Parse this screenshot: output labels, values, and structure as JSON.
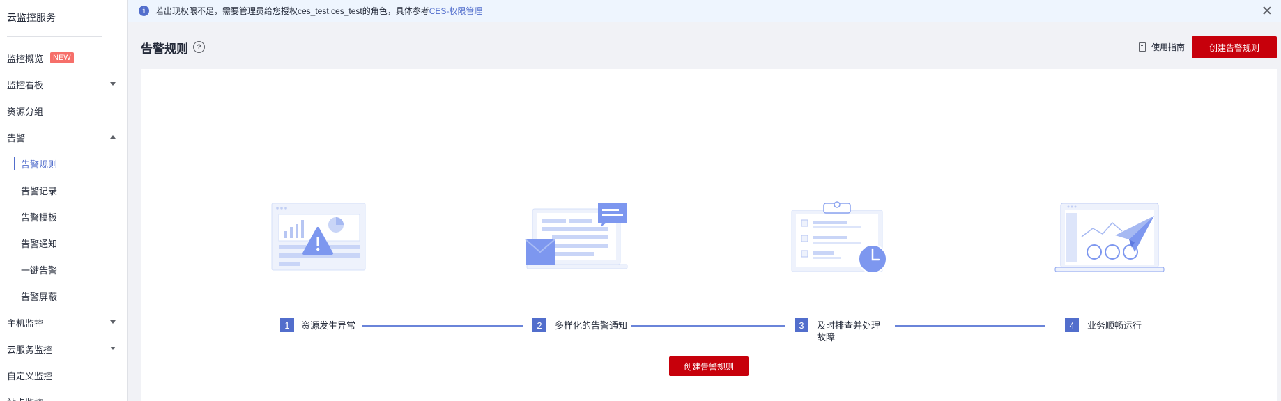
{
  "sidebar": {
    "title": "云监控服务",
    "items": [
      {
        "label": "监控概览",
        "badge": "NEW"
      },
      {
        "label": "监控看板"
      },
      {
        "label": "资源分组"
      },
      {
        "label": "告警"
      },
      {
        "label": "告警规则"
      },
      {
        "label": "告警记录"
      },
      {
        "label": "告警模板"
      },
      {
        "label": "告警通知"
      },
      {
        "label": "一键告警"
      },
      {
        "label": "告警屏蔽"
      },
      {
        "label": "主机监控"
      },
      {
        "label": "云服务监控"
      },
      {
        "label": "自定义监控"
      },
      {
        "label": "站点监控"
      }
    ]
  },
  "banner": {
    "text": "若出现权限不足，需要管理员给您授权ces_test,ces_test的角色，具体参考",
    "link": "CES-权限管理"
  },
  "header": {
    "title": "告警规则",
    "guide_label": "使用指南",
    "create_label": "创建告警规则"
  },
  "steps": [
    {
      "num": "1",
      "label": "资源发生异常"
    },
    {
      "num": "2",
      "label": "多样化的告警通知"
    },
    {
      "num": "3",
      "label": "及时排查并处理故障"
    },
    {
      "num": "4",
      "label": "业务顺畅运行"
    }
  ],
  "main": {
    "create_label": "创建告警规则"
  },
  "colors": {
    "accent": "#526ecc",
    "brand_red": "#c7000b",
    "illustration_blue": "#7d97ef",
    "illustration_light": "#e8eefc"
  }
}
